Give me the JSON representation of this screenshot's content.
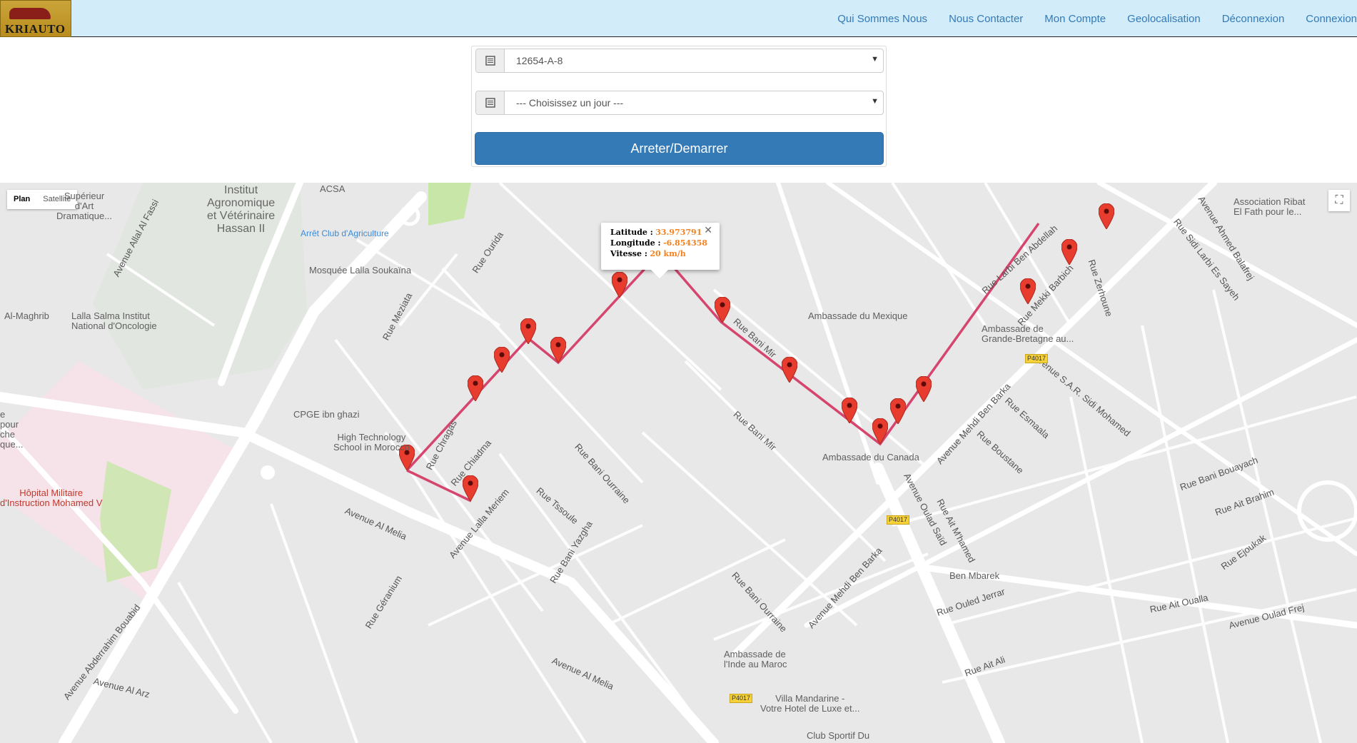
{
  "header": {
    "logo_text": "KRIAUTO",
    "nav": [
      "Qui Sommes Nous",
      "Nous Contacter",
      "Mon Compte",
      "Geolocalisation",
      "Déconnexion",
      "Connexion"
    ]
  },
  "form": {
    "vehicle_select": "12654-A-8",
    "day_select": "--- Choisissez un jour ---",
    "button": "Arreter/Demarrer"
  },
  "map": {
    "type_plan": "Plan",
    "type_satellite": "Satellite",
    "info": {
      "lat_label": "Latitude :",
      "lat": "33.973791",
      "lon_label": "Longitude :",
      "lon": "-6.854358",
      "speed_label": "Vitesse :",
      "speed": "20 km/h"
    },
    "route_color": "#d6456e",
    "marker_color": "#e83c2e",
    "places": {
      "institut": "Institut\nAgronomique\net Vétérinaire\nHassan II",
      "acsa": "ACSA",
      "arret": "Arrêt Club d'Agriculture",
      "mosquee": "Mosquée Lalla Soukaïna",
      "lalla_salma": "Lalla Salma Institut\nNational d'Oncologie",
      "cpge": "CPGE ibn ghazi",
      "hts": "High Technology\nSchool in Morocco",
      "hopital": "Hôpital Militaire\nd'Instruction Mohamed V",
      "mexique": "Ambassade du Mexique",
      "grande_bretagne": "Ambassade de\nGrande-Bretagne au...",
      "canada": "Ambassade du Canada",
      "ben_mbarek": "Ben Mbarek",
      "inde": "Ambassade de\nl'Inde au Maroc",
      "villa": "Villa Mandarine -\nVotre Hotel de Luxe et...",
      "club": "Club Sportif Du",
      "association": "Association Ribat\nEl Fath pour le...",
      "superieur": "Supérieur\nd'Art\nDramatique...",
      "maghrib": "Al-Maghrib",
      "pour": "e\npour\nche\nque..."
    },
    "streets": {
      "bani_mir": "Rue Bani Mir",
      "al_melia": "Avenue Al Melia",
      "ouled_said": "Avenue Oulad Saïd",
      "mehdi": "Avenue Mehdi Ben Barka",
      "bani_ourraine": "Rue Bani Ourraine",
      "allal": "Avenue Allal Al Fassi",
      "zerhoune": "Rue Zerhoune",
      "sar": "Avenue S.A.R. Sidi Mohamed",
      "lalla_meriem": "Avenue Lalla Meriem",
      "ouled_frej": "Avenue Oulad Frej",
      "chiadma": "Rue Chiadma",
      "tssoule": "Rue Tssoule",
      "bani_yazgha": "Rue Bani Yazgha",
      "boustane": "Rue Boustane",
      "esmaala": "Rue Esmaala",
      "abderrahim": "Avenue Abderrahim Bouabid",
      "arz": "Avenue Al Arz",
      "ouled_jerrar": "Rue Ouled Jerrar",
      "ait_oualla": "Rue Ait Oualla",
      "ait_ali": "Rue Ait Ali",
      "bani_bouayach": "Rue Bani Bouayach",
      "ait_brahim": "Rue Ait Brahim",
      "ait_mhamed": "Rue Ait M'hamed",
      "geranium": "Rue Géranium",
      "ejoukak": "Rue Ejoukak",
      "ahmed_balafrej": "Avenue Ahmed Balafrej",
      "sidi_larbi": "Rue Sidi Larbi Es Sayeh",
      "larbi_abdellah": "Rue Larbi Ben Abdellah",
      "mekki": "Rue Mekki Barbich",
      "meziata": "Rue Meziata",
      "ourida": "Rue Ourida",
      "chragas": "Rue Chragas",
      "p4017": "P4017"
    }
  }
}
